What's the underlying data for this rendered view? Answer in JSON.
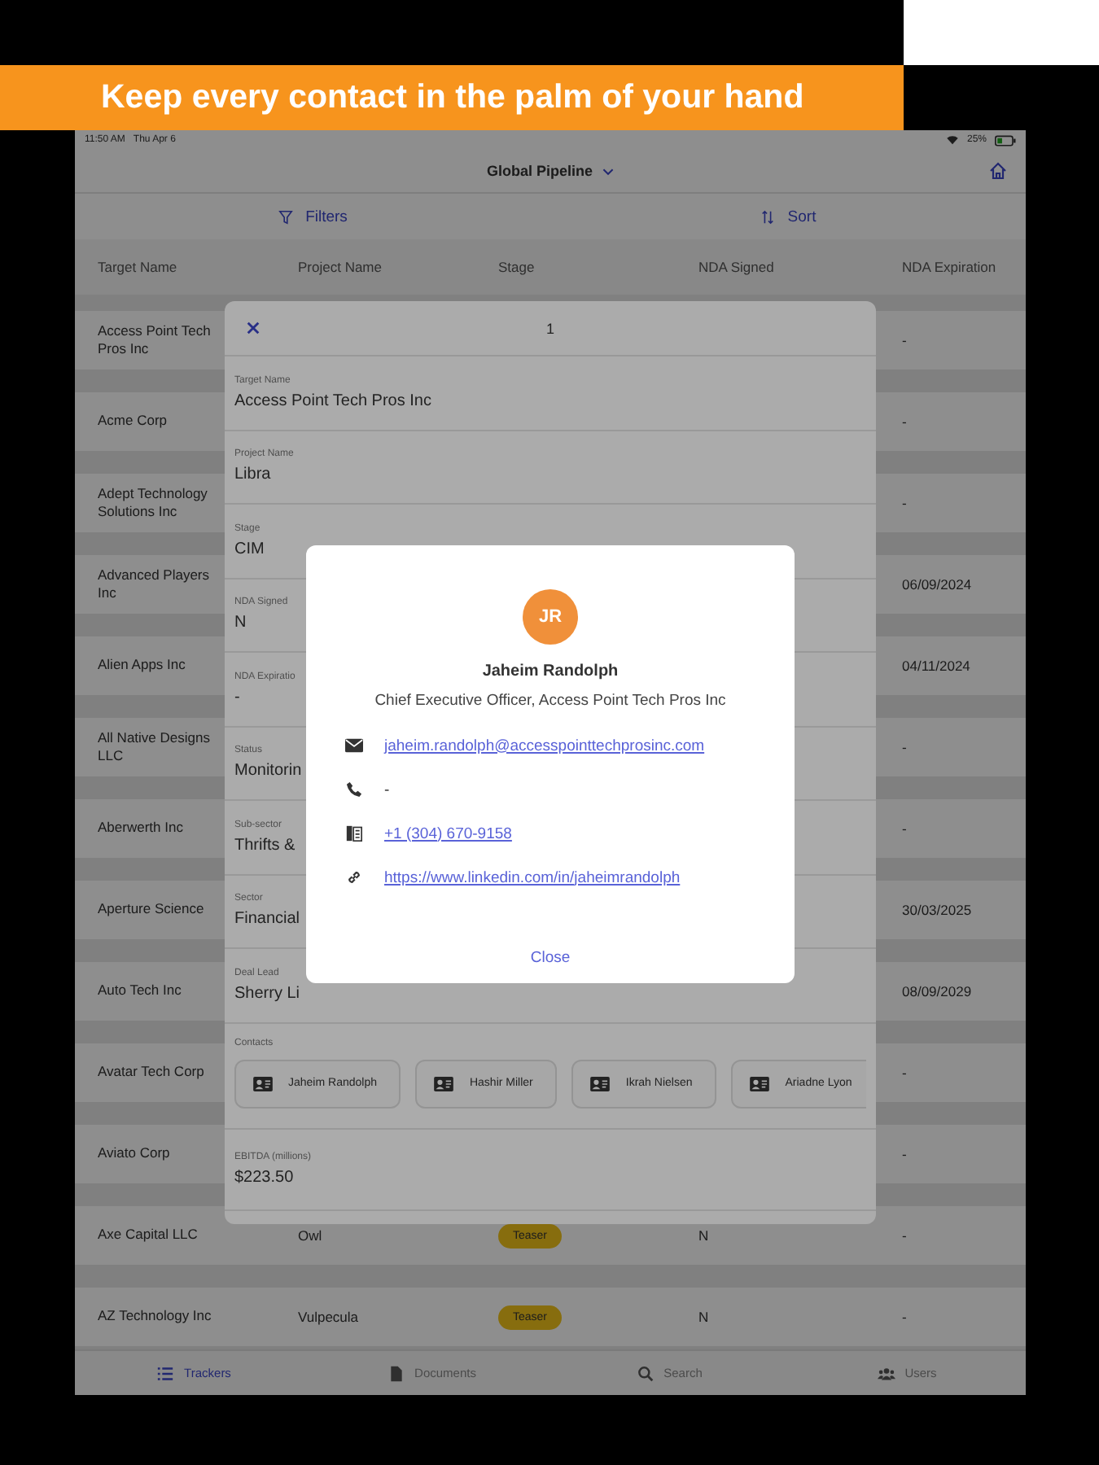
{
  "banner": {
    "headline": "Keep every contact in the palm of your hand"
  },
  "status_bar": {
    "time": "11:50 AM",
    "date": "Thu Apr 6",
    "battery": "25%"
  },
  "nav": {
    "title": "Global Pipeline"
  },
  "toolbar": [
    {
      "label": "Filters",
      "kind": "filter"
    },
    {
      "label": "Sort",
      "kind": "sort"
    }
  ],
  "table": {
    "columns": [
      "Target Name",
      "Project Name",
      "Stage",
      "NDA Signed",
      "NDA Expiration"
    ],
    "rows": [
      {
        "target": "Access Point Tech Pros Inc",
        "expiration": "-"
      },
      {
        "target": "Acme Corp",
        "expiration": "-"
      },
      {
        "target": "Adept Technology Solutions Inc",
        "expiration": "-"
      },
      {
        "target": "Advanced Players Inc",
        "expiration": "06/09/2024"
      },
      {
        "target": "Alien Apps Inc",
        "expiration": "04/11/2024"
      },
      {
        "target": "All Native Designs LLC",
        "expiration": "-"
      },
      {
        "target": "Aberwerth Inc",
        "expiration": "-"
      },
      {
        "target": "Aperture Science",
        "expiration": "30/03/2025"
      },
      {
        "target": "Auto Tech Inc",
        "expiration": "08/09/2029"
      },
      {
        "target": "Avatar Tech Corp",
        "expiration": "-"
      },
      {
        "target": "Aviato Corp",
        "expiration": "-"
      },
      {
        "target": "Axe Capital LLC",
        "project": "Owl",
        "stage": "Teaser",
        "nda_signed": "N",
        "expiration": "-"
      },
      {
        "target": "AZ Technology Inc",
        "project": "Vulpecula",
        "stage": "Teaser",
        "nda_signed": "N",
        "expiration": "-"
      }
    ]
  },
  "sheet": {
    "counter": "1",
    "fields": [
      {
        "label": "Target Name",
        "value": "Access Point Tech Pros Inc"
      },
      {
        "label": "Project Name",
        "value": "Libra"
      },
      {
        "label": "Stage",
        "value": "CIM"
      },
      {
        "label": "NDA Signed",
        "value": "N"
      },
      {
        "label": "NDA Expiratio",
        "value": "-"
      },
      {
        "label": "Status",
        "value": "Monitorin"
      },
      {
        "label": "Sub-sector",
        "value": "Thrifts &"
      },
      {
        "label": "Sector",
        "value": "Financial"
      },
      {
        "label": "Deal Lead",
        "value": "Sherry Li"
      }
    ],
    "contacts": {
      "label": "Contacts",
      "people": [
        "Jaheim Randolph",
        "Hashir Miller",
        "Ikrah Nielsen",
        "Ariadne Lyon"
      ]
    },
    "metrics": [
      {
        "label": "EBITDA (millions)",
        "value": "$223.50"
      }
    ]
  },
  "dialog": {
    "initials": "JR",
    "name": "Jaheim Randolph",
    "title": "Chief Executive Officer, Access Point Tech Pros Inc",
    "details": [
      {
        "kind": "email",
        "text": "jaheim.randolph@accesspointtechprosinc.com",
        "link": true
      },
      {
        "kind": "phone",
        "text": "-",
        "link": false
      },
      {
        "kind": "office",
        "text": "+1 (304) 670-9158",
        "link": true
      },
      {
        "kind": "website",
        "text": "https://www.linkedin.com/in/jaheimrandolph",
        "link": true
      }
    ],
    "close": "Close"
  },
  "tab_bar": [
    {
      "label": "Trackers",
      "kind": "trackers",
      "selected": true
    },
    {
      "label": "Documents",
      "kind": "documents",
      "selected": false
    },
    {
      "label": "Search",
      "kind": "search",
      "selected": false
    },
    {
      "label": "Users",
      "kind": "users",
      "selected": false
    }
  ]
}
